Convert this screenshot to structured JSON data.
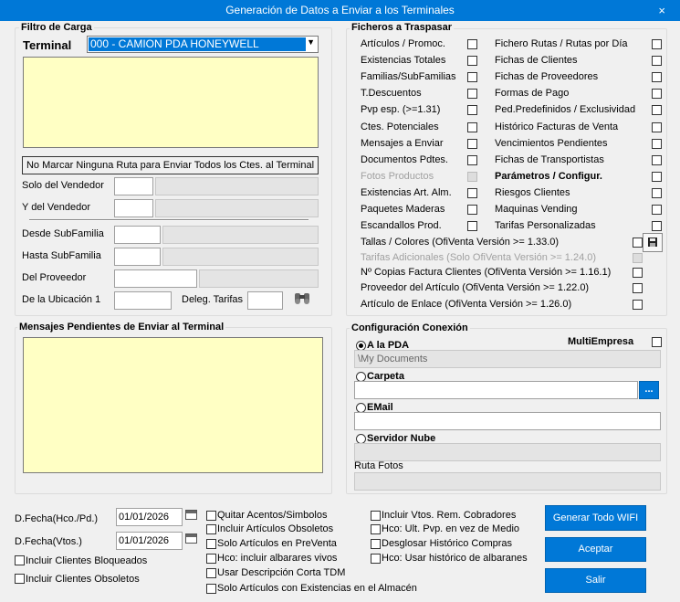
{
  "window": {
    "title": "Generación de Datos a Enviar a los Terminales",
    "close": "×"
  },
  "filtro": {
    "title": "Filtro de Carga",
    "terminal_label": "Terminal",
    "terminal_value": "000 - CAMION PDA HONEYWELL",
    "routes_note": "No Marcar Ninguna Ruta para Enviar Todos los Ctes. al Terminal",
    "solo_vendedor": "Solo del Vendedor",
    "y_vendedor": "Y del Vendedor",
    "desde_subfamilia": "Desde SubFamilia",
    "hasta_subfamilia": "Hasta SubFamilia",
    "del_proveedor": "Del Proveedor",
    "ubicacion": "De la Ubicación 1",
    "deleg_tarifas": "Deleg. Tarifas"
  },
  "ficheros": {
    "title": "Ficheros a Traspasar",
    "left": [
      "Artículos / Promoc.",
      "Existencias Totales",
      "Familias/SubFamilias",
      "T.Descuentos",
      "Pvp esp. (>=1.31)",
      "Ctes. Potenciales",
      "Mensajes a Enviar",
      "Documentos Pdtes.",
      "Fotos Productos",
      "Existencias Art. Alm.",
      "Paquetes Maderas",
      "Escandallos Prod."
    ],
    "right": [
      "Fichero Rutas / Rutas por Día",
      "Fichas de Clientes",
      "Fichas de Proveedores",
      "Formas de Pago",
      "Ped.Predefinidos / Exclusividad",
      "Histórico Facturas de Venta",
      "Vencimientos Pendientes",
      "Fichas de Transportistas",
      "Parámetros / Configur.",
      "Riesgos Clientes",
      "Maquinas Vending",
      "Tarifas Personalizadas"
    ],
    "wide": [
      "Tallas / Colores (OfiVenta Versión >= 1.33.0)",
      "Tarifas Adicionales (Solo OfiVenta Versión >= 1.24.0)",
      "Nº Copias Factura Clientes (OfiVenta Versión >= 1.16.1)",
      "Proveedor del Artículo (OfiVenta Versión >= 1.22.0)",
      "Artículo de Enlace (OfiVenta Versión >= 1.26.0)"
    ]
  },
  "mensajes": {
    "title": "Mensajes Pendientes de Enviar al Terminal"
  },
  "conexion": {
    "title": "Configuración Conexión",
    "multiempresa": "MultiEmpresa",
    "pda": "A la PDA",
    "pda_path": "\\My Documents",
    "carpeta": "Carpeta",
    "browse": "...",
    "email": "EMail",
    "nube": "Servidor Nube",
    "ruta_fotos": "Ruta Fotos"
  },
  "bottom": {
    "fecha_hco_label": "D.Fecha(Hco./Pd.)",
    "fecha_hco": "01/01/2026",
    "fecha_vtos_label": "D.Fecha(Vtos.)",
    "fecha_vtos": "01/01/2026",
    "bloqueados": "Incluir Clientes Bloqueados",
    "obsoletos": "Incluir Clientes Obsoletos",
    "mid": [
      "Quitar Acentos/Simbolos",
      "Incluir Artículos Obsoletos",
      "Solo Artículos en PreVenta",
      "Hco: incluir albarares vivos",
      "Usar Descripción Corta TDM",
      "Solo Artículos con Existencias en el Almacén"
    ],
    "right": [
      "Incluir Vtos. Rem. Cobradores",
      "Hco: Ult. Pvp. en vez de Medio",
      "Desglosar Histórico Compras",
      "Hco: Usar histórico de albaranes"
    ],
    "btn_wifi": "Generar Todo WIFI",
    "btn_aceptar": "Aceptar",
    "btn_salir": "Salir"
  }
}
